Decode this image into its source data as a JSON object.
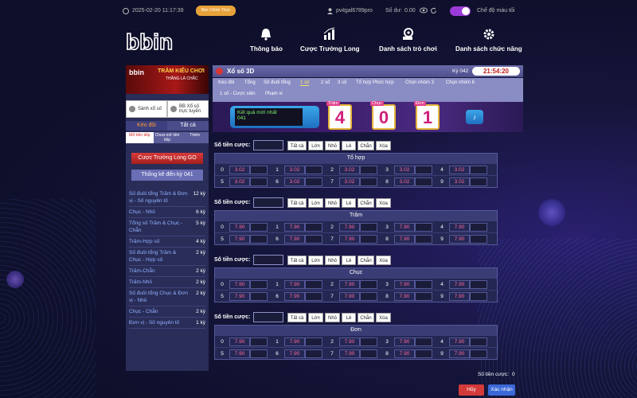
{
  "topbar": {
    "datetime": "2025-02-20 11:17:39",
    "official_btn": "Bản Chính Thức",
    "username": "pvitgal6789pro",
    "balance_label": "Số dư:",
    "balance_value": "0.00",
    "darkmode_label": "Chế độ màu tối"
  },
  "logo_text": "bbin",
  "nav": [
    {
      "label": "Thông báo",
      "icon": "bell-icon"
    },
    {
      "label": "Cược Trường Long",
      "icon": "bar-chart-icon"
    },
    {
      "label": "Danh sách trò chơi",
      "icon": "ball-machine-icon"
    },
    {
      "label": "Danh sách chức năng",
      "icon": "gear-icon"
    }
  ],
  "sidebar": {
    "banner_brand": "bbin",
    "banner_title": "TRĂM KIỂU CHƠI",
    "banner_sub": "THẮNG LÀ CHẮC",
    "lobby_left": "Sảnh xổ số",
    "lobby_right": "BB Xổ số trực tuyến",
    "tab_keo": "Kéo đôi",
    "tab_tatca": "Tất cả",
    "tab_mo": "Mở tiền tiếp",
    "tab_chuamo": "Chưa mở tiền tiếp",
    "tab_them": "Thêm",
    "cuoc_btn": "Cược Trường Long GO",
    "thongke_btn": "Thống kê đến kỳ 041",
    "stats": [
      {
        "name": "Số đuôi tổng Trăm & Đơn vị - Số nguyên tố",
        "count": "12 kỳ"
      },
      {
        "name": "Chục - Nhỏ",
        "count": "6 kỳ"
      },
      {
        "name": "Tổng số Trăm & Chục - Chẵn",
        "count": "5 kỳ"
      },
      {
        "name": "Trăm-Hợp số",
        "count": "4 kỳ"
      },
      {
        "name": "Số đuôi tổng Trăm & Chục - Hợp số",
        "count": "2 kỳ"
      },
      {
        "name": "Trăm-Chẵn",
        "count": "2 kỳ"
      },
      {
        "name": "Trăm-Nhỏ",
        "count": "2 kỳ"
      },
      {
        "name": "Số đuôi tổng Chục & Đơn vị - Nhỏ",
        "count": "2 kỳ"
      },
      {
        "name": "Chục - Chẵn",
        "count": "2 kỳ"
      },
      {
        "name": "Đơn vị - Số nguyên tố",
        "count": "1 kỳ"
      }
    ]
  },
  "game": {
    "title": "Xổ số 3D",
    "period": "Kỳ 042",
    "timer": "21:54:20",
    "tabs_row1": [
      "Kéo đôi",
      "Tổng",
      "Số đuôi tổng",
      "1 số",
      "2 số",
      "3 số",
      "Tổ hợp Phức hợp",
      "Chọn nhóm 3",
      "Chọn nhóm 6"
    ],
    "tabs_row2": [
      "1 số - Cược xiên",
      "Phạm vi"
    ],
    "result_label": "Kết quả mới nhất",
    "result_period": "041",
    "digits": [
      {
        "label": "Trăm",
        "value": "4"
      },
      {
        "label": "Chục",
        "value": "0"
      },
      {
        "label": "Đơn",
        "value": "1"
      }
    ],
    "sound_icon": "speaker-icon"
  },
  "bet": {
    "amount_label": "Số tiền cược:",
    "quick": [
      "Tất cả",
      "Lớn",
      "Nhỏ",
      "Lẻ",
      "Chẵn",
      "Xóa"
    ],
    "sections": [
      {
        "title": "Tổ hợp",
        "odds": [
          "3.02",
          "3.02",
          "3.02",
          "3.02",
          "3.02",
          "3.02",
          "3.02",
          "3.02",
          "3.02",
          "3.02"
        ]
      },
      {
        "title": "Trăm",
        "odds": [
          "7.90",
          "7.90",
          "7.90",
          "7.90",
          "7.90",
          "7.90",
          "7.90",
          "7.90",
          "7.90",
          "7.90"
        ]
      },
      {
        "title": "Chục",
        "odds": [
          "7.90",
          "7.90",
          "7.90",
          "7.90",
          "7.90",
          "7.90",
          "7.90",
          "7.90",
          "7.90",
          "7.90"
        ]
      },
      {
        "title": "Đơn",
        "odds": [
          "7.90",
          "7.90",
          "7.90",
          "7.90",
          "7.90",
          "7.90",
          "7.90",
          "7.90",
          "7.90",
          "7.90"
        ]
      }
    ],
    "numbers": [
      "0",
      "1",
      "2",
      "3",
      "4",
      "5",
      "6",
      "7",
      "8",
      "9"
    ],
    "total_label": "Số tiền cược:",
    "total_value": "0",
    "cancel": "Hủy",
    "confirm": "Xác nhận"
  }
}
